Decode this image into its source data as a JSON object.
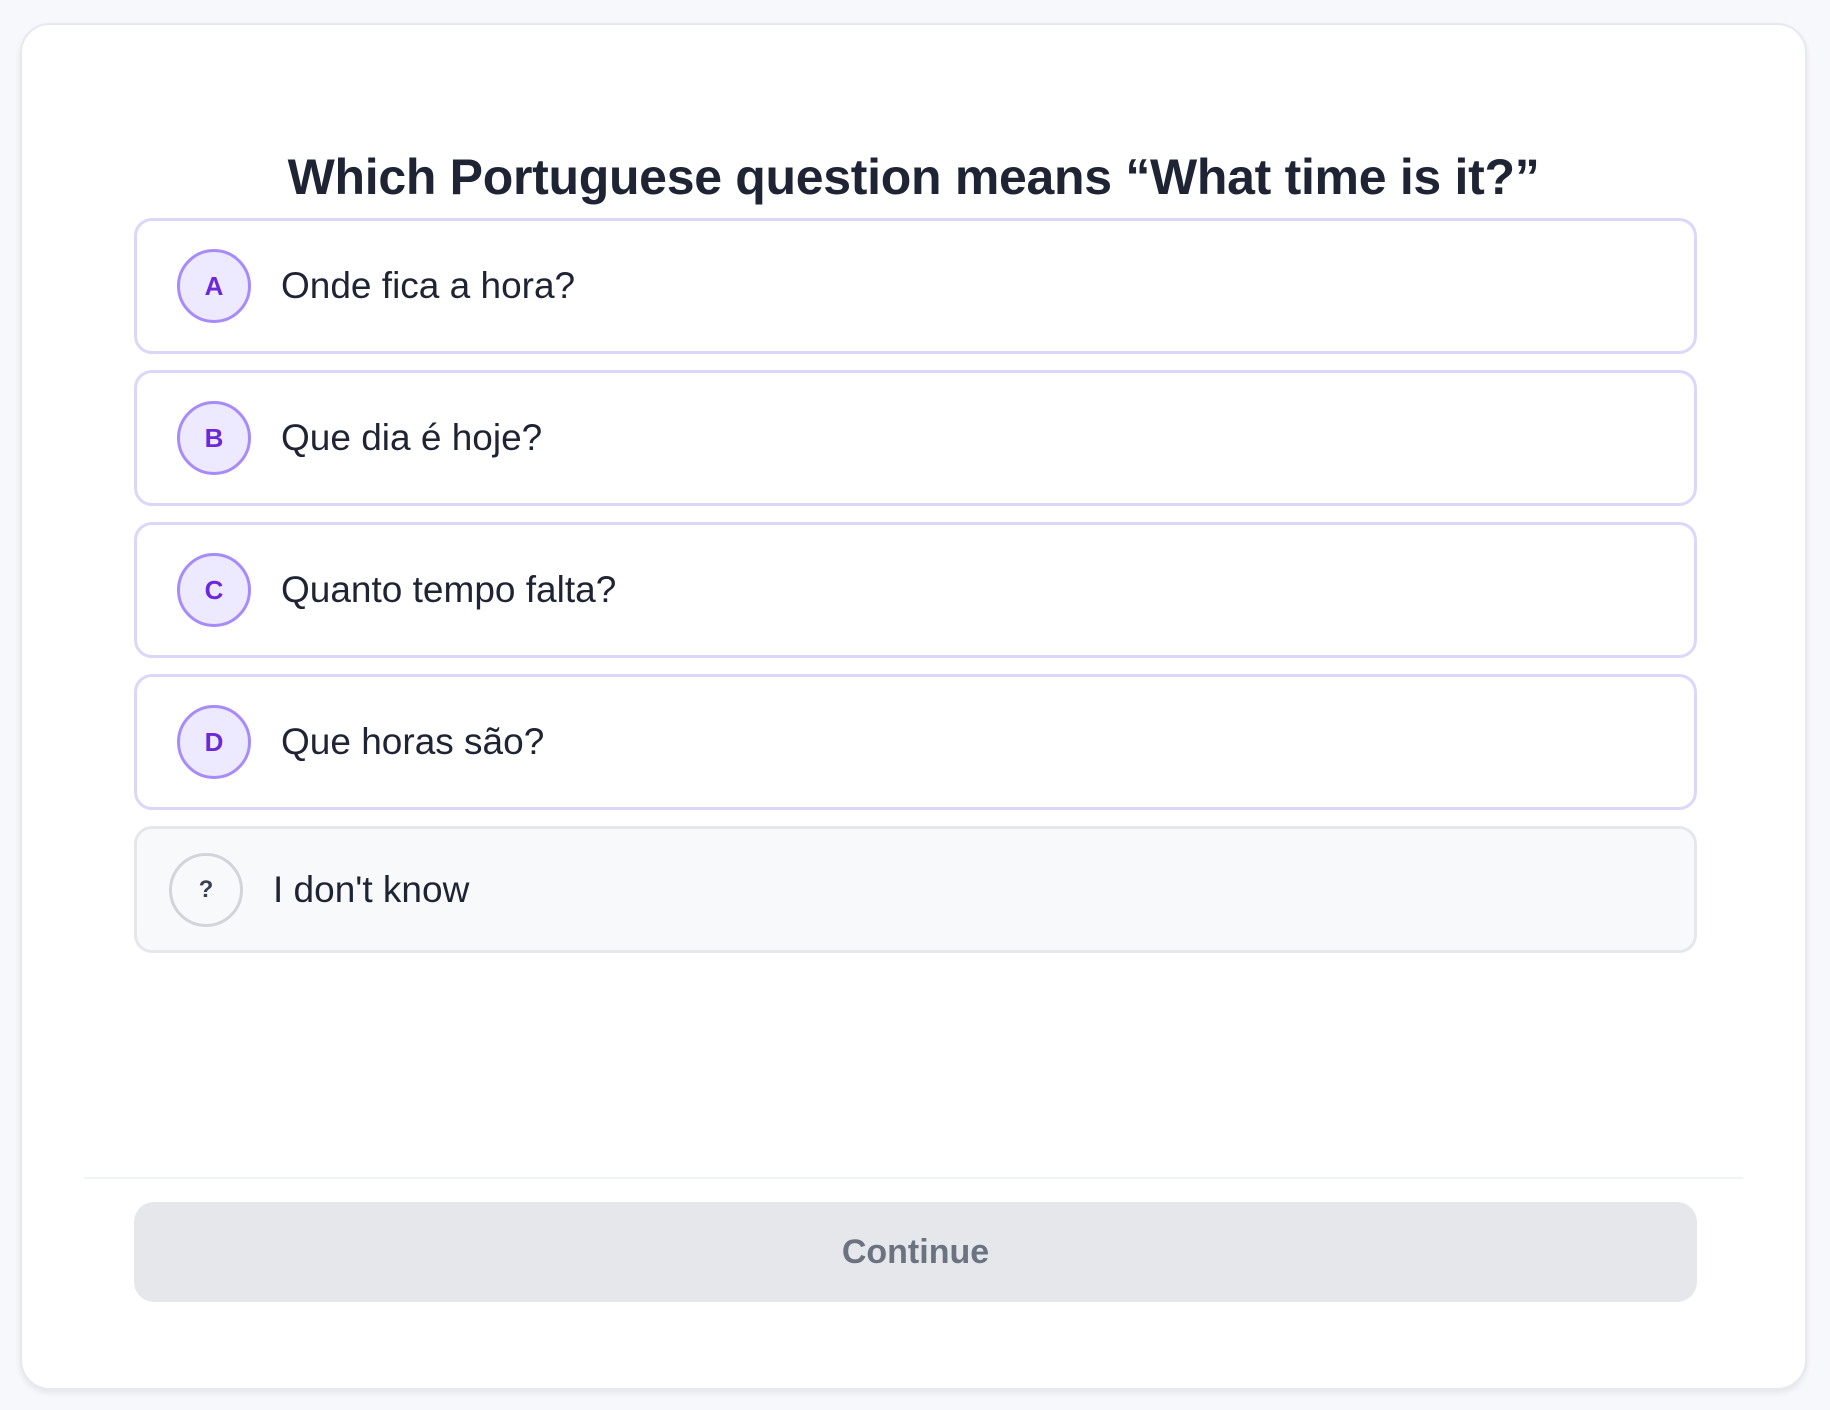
{
  "quiz": {
    "question": "Which Portuguese question means “What time is it?”",
    "options": [
      {
        "key": "A",
        "text": "Onde fica a hora?"
      },
      {
        "key": "B",
        "text": "Que dia é hoje?"
      },
      {
        "key": "C",
        "text": "Quanto tempo falta?"
      },
      {
        "key": "D",
        "text": "Que horas são?"
      }
    ],
    "unknown_option": {
      "key": "?",
      "text": "I don't know"
    },
    "continue_label": "Continue",
    "continue_enabled": false
  },
  "colors": {
    "page_background": "#f7f8fc",
    "card_background": "#ffffff",
    "accent": "#6d28d9",
    "option_border": "#dcd6fb",
    "badge_fill": "#ede9fe",
    "badge_border": "#a78bfa",
    "button_disabled": "#e5e7eb",
    "button_text_disabled": "#6b7280",
    "text_primary": "#1e2433"
  }
}
